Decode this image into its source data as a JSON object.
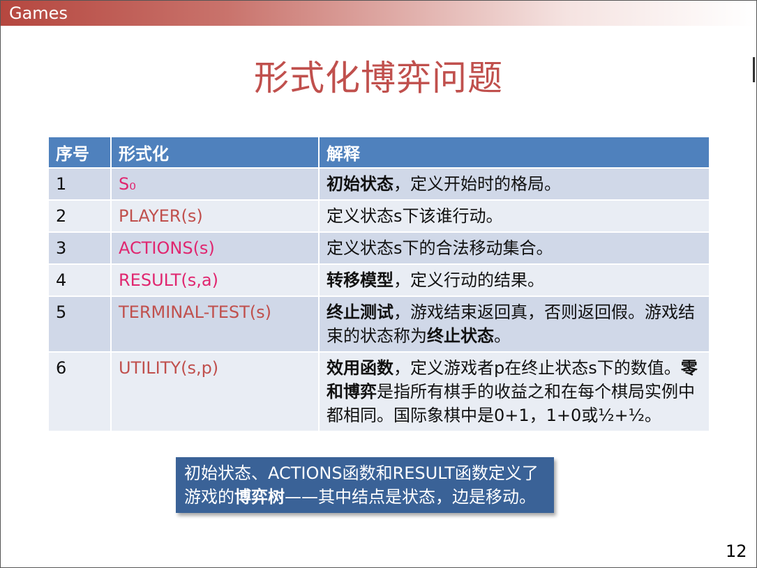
{
  "header": {
    "label": "Games"
  },
  "title": "形式化博弈问题",
  "table": {
    "headers": [
      "序号",
      "形式化",
      "解释"
    ],
    "rows": [
      {
        "num": "1",
        "formal": "S₀",
        "formal_style": "pink",
        "bold": "初始状态",
        "text": "，定义开始时的格局。",
        "bold2": "",
        "text2": ""
      },
      {
        "num": "2",
        "formal": "PLAYER(s)",
        "formal_style": "red",
        "bold": "",
        "text": "定义状态s下该谁行动。",
        "bold2": "",
        "text2": ""
      },
      {
        "num": "3",
        "formal": "ACTIONS(s)",
        "formal_style": "pink",
        "bold": "",
        "text": "定义状态s下的合法移动集合。",
        "bold2": "",
        "text2": ""
      },
      {
        "num": "4",
        "formal": "RESULT(s,a)",
        "formal_style": "pink",
        "bold": "转移模型",
        "text": "，定义行动的结果。",
        "bold2": "",
        "text2": ""
      },
      {
        "num": "5",
        "formal": "TERMINAL-TEST(s)",
        "formal_style": "red",
        "bold": "终止测试",
        "text": "，游戏结束返回真，否则返回假。游戏结束的状态称为",
        "bold2": "终止状态",
        "text2": "。"
      },
      {
        "num": "6",
        "formal": "UTILITY(s,p)",
        "formal_style": "red",
        "bold": "效用函数",
        "text": "，定义游戏者p在终止状态s下的数值。",
        "bold2": "零和博弈",
        "text2": "是指所有棋手的收益之和在每个棋局实例中都相同。国际象棋中是0+1，1+0或½+½。"
      }
    ]
  },
  "note": {
    "text_a": "初始状态、ACTIONS函数和RESULT函数定义了游戏的",
    "bold": "博弈树",
    "text_b": "——其中结点是状态，边是移动。"
  },
  "page_number": "12",
  "colors": {
    "accent": "#c0504d",
    "table_header": "#4f81bd",
    "note_bg": "#3a6297",
    "pink": "#e0266f"
  }
}
